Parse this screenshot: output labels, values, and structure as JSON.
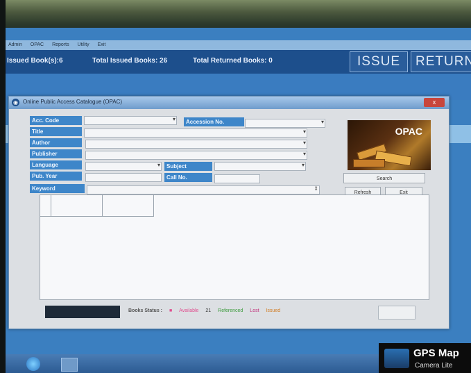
{
  "menubar": {
    "items": [
      "Admin",
      "OPAC",
      "Reports",
      "Utility",
      "Exit"
    ]
  },
  "stats": {
    "issued_label": "Issued Book(s):6",
    "total_issued": "Total Issued Books: 26",
    "total_returned": "Total Returned Books: 0"
  },
  "actions": {
    "issue": "ISSUE",
    "return": "RETURN"
  },
  "dialog": {
    "title": "Online Public Access Catalogue (OPAC)",
    "close": "x",
    "labels": {
      "acc_code": "Acc. Code",
      "accession_no": "Accession No.",
      "title": "Title",
      "author": "Author",
      "publisher": "Publisher",
      "language": "Language",
      "subject": "Subject",
      "pub_year": "Pub. Year",
      "call_no": "Call No.",
      "keyword": "Keyword"
    },
    "logo": "OPAC",
    "buttons": {
      "search": "Search",
      "refresh": "Refresh",
      "exit": "Exit"
    }
  },
  "status": {
    "label": "Books Status :",
    "available": "Available",
    "count": "21",
    "referenced": "Referenced",
    "lost": "Lost",
    "issued": "Issued"
  },
  "colors": {
    "available": "#e05090",
    "referenced": "#3a9a3a",
    "lost": "#c0307a",
    "issued": "#d07a20"
  },
  "watermark": {
    "title": "GPS Map",
    "subtitle": "Camera Lite"
  }
}
